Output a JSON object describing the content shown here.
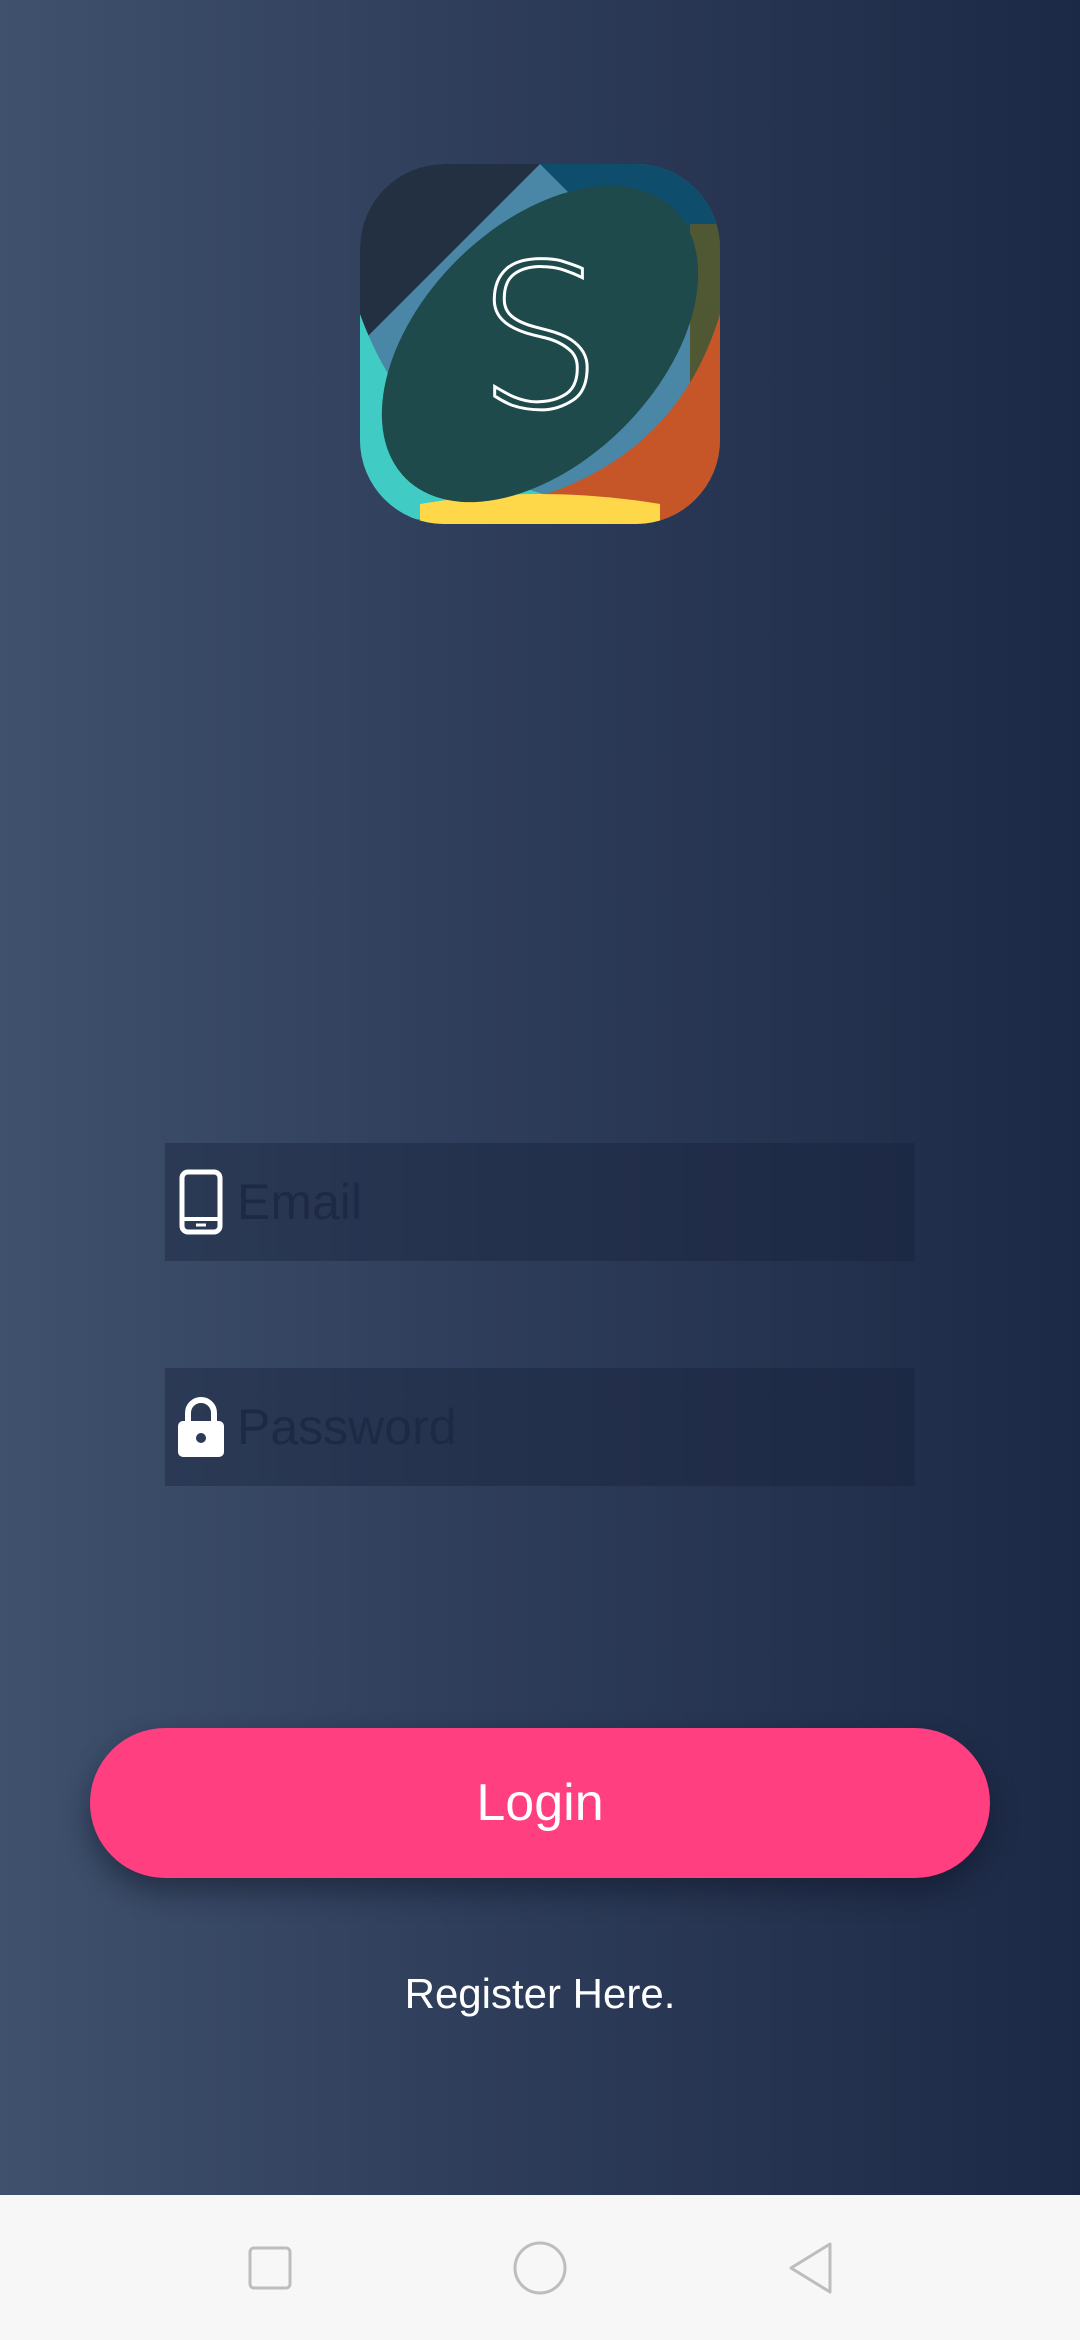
{
  "logo": {
    "letter": "S",
    "colors": {
      "teal": "#40cbc4",
      "orange": "#c65527",
      "yellow": "#ffd84a",
      "navy": "#223042",
      "blue": "#0e4d6b",
      "center": "#1e4a4b"
    }
  },
  "form": {
    "email": {
      "placeholder": "Email",
      "value": "",
      "icon": "phone-icon"
    },
    "password": {
      "placeholder": "Password",
      "value": "",
      "icon": "lock-icon"
    }
  },
  "actions": {
    "login_label": "Login",
    "register_label": "Register Here."
  },
  "theme": {
    "accent": "#ff3f7f",
    "background_start": "#3f516d",
    "background_end": "#1c2946"
  },
  "navbar": {
    "buttons": [
      "recents-icon",
      "home-icon",
      "back-icon"
    ]
  }
}
